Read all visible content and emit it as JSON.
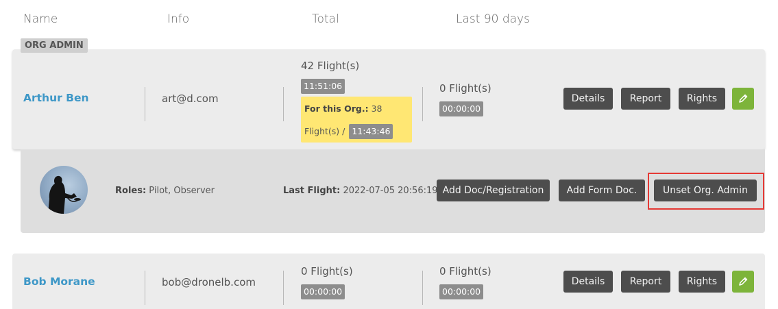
{
  "columns": [
    "Name",
    "Info",
    "Total",
    "Last 90 days"
  ],
  "group_tag": "ORG ADMIN",
  "users": [
    {
      "name": "Arthur Ben",
      "email": "art@d.com",
      "total_flights": "42 Flight(s)",
      "total_time": "11:51:06",
      "org": {
        "label": "For this Org.:",
        "count": "38",
        "flights_prefix": "Flight(s) /",
        "time": "11:43:46"
      },
      "last90_flights": "0 Flight(s)",
      "last90_time": "00:00:00",
      "details": {
        "roles_label": "Roles:",
        "roles_value": "Pilot, Observer",
        "last_flight_label": "Last Flight:",
        "last_flight_value": "2022-07-05 20:56:19"
      }
    },
    {
      "name": "Bob Morane",
      "email": "bob@dronelb.com",
      "total_flights": "0 Flight(s)",
      "total_time": "00:00:00",
      "last90_flights": "0 Flight(s)",
      "last90_time": "00:00:00"
    }
  ],
  "row_buttons": {
    "details": "Details",
    "report": "Report",
    "rights": "Rights",
    "edit_icon": "pencil-icon"
  },
  "detail_buttons": {
    "add_doc": "Add Doc/Registration",
    "add_form": "Add Form Doc.",
    "unset_admin": "Unset Org. Admin"
  },
  "colors": {
    "name_link": "#3d97c7",
    "button_dark": "#4d4d4d",
    "edit_green": "#7db43a",
    "org_highlight": "#ffe773",
    "time_badge": "#8d8d8d",
    "annotation_red": "#e53935"
  }
}
